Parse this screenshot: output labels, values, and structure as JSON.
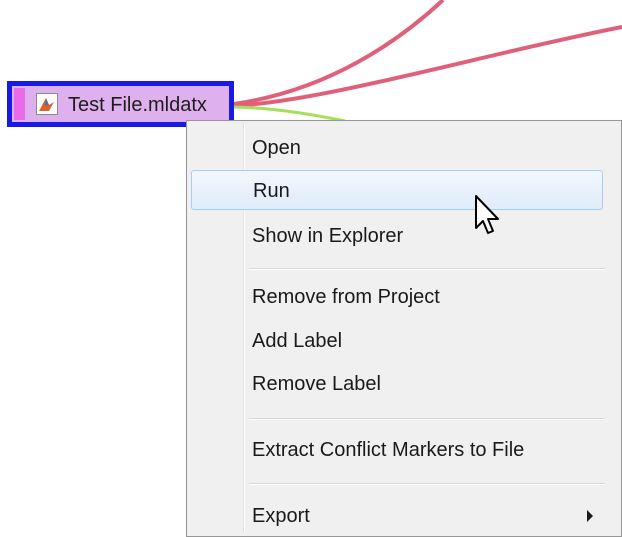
{
  "file_node": {
    "label": "Test File.mldatx",
    "icon": "matlab-file-icon",
    "colors": {
      "border": "#1a1ae6",
      "fill": "#dfb0ee",
      "stripe": "#ea6bea"
    }
  },
  "context_menu": {
    "items": [
      {
        "label": "Open"
      },
      {
        "label": "Run"
      },
      {
        "label": "Show in Explorer"
      },
      {
        "label": "Remove from Project"
      },
      {
        "label": "Add Label"
      },
      {
        "label": "Remove Label"
      },
      {
        "label": "Extract Conflict Markers to File"
      },
      {
        "label": "Export"
      }
    ],
    "highlighted_item": "Run",
    "submenu_item": "Export"
  },
  "edge_colors": {
    "red": "#e0607a",
    "green": "#a6e05a"
  }
}
